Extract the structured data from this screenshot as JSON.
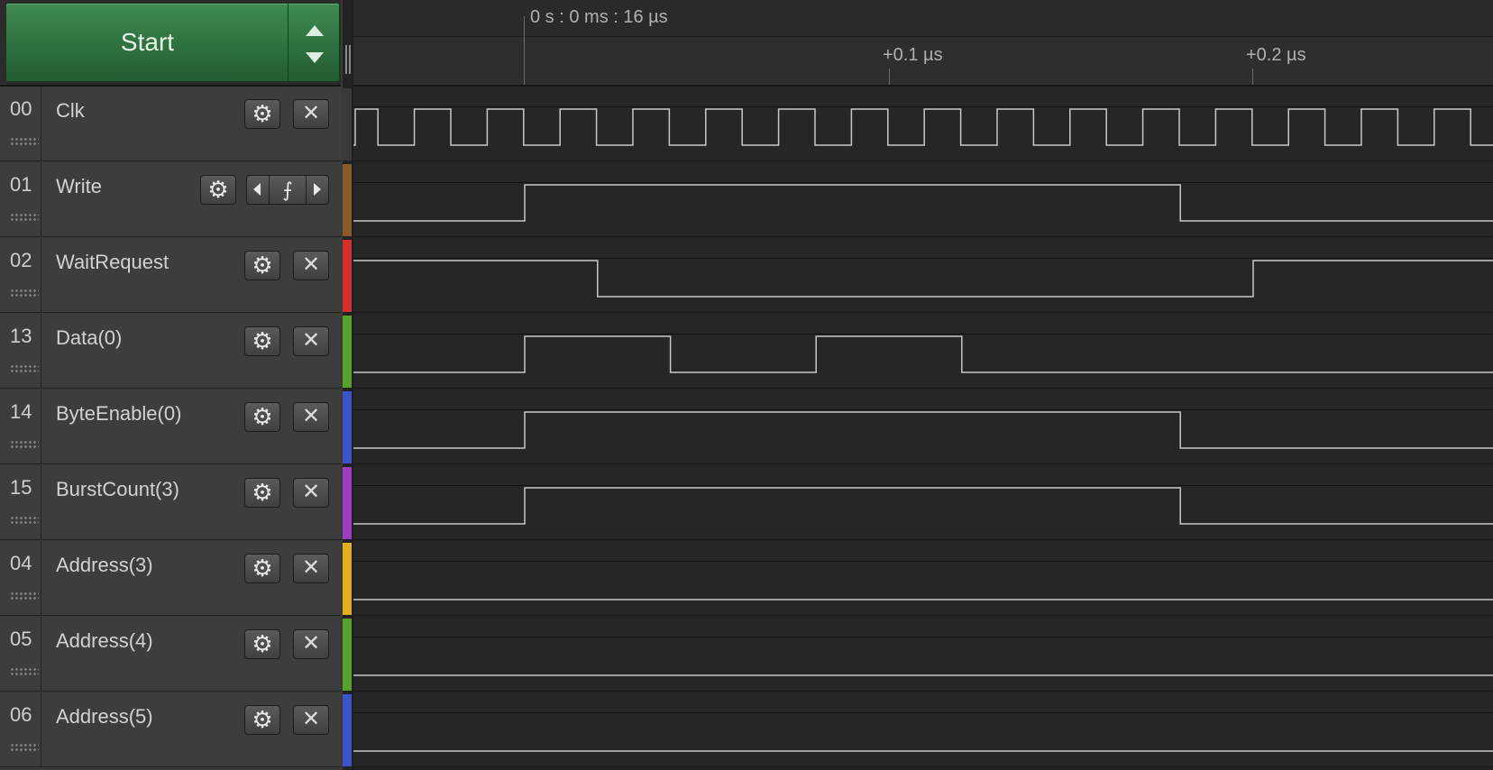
{
  "start_button": {
    "label": "Start"
  },
  "timeline": {
    "origin_label": "0 s : 0 ms : 16 µs",
    "ticks": [
      {
        "label": "+0.1 µs"
      },
      {
        "label": "+0.2 µs"
      }
    ]
  },
  "channels": [
    {
      "number": "00",
      "name": "Clk",
      "color": "#3a3a3a",
      "control": "settings"
    },
    {
      "number": "01",
      "name": "Write",
      "color": "#8b5a2b",
      "control": "trigger"
    },
    {
      "number": "02",
      "name": "WaitRequest",
      "color": "#d4302a",
      "control": "settings"
    },
    {
      "number": "13",
      "name": "Data(0)",
      "color": "#5aa02c",
      "control": "settings"
    },
    {
      "number": "14",
      "name": "ByteEnable(0)",
      "color": "#3b55c8",
      "control": "settings"
    },
    {
      "number": "15",
      "name": "BurstCount(3)",
      "color": "#9b3fbf",
      "control": "settings"
    },
    {
      "number": "04",
      "name": "Address(3)",
      "color": "#e0b020",
      "control": "settings"
    },
    {
      "number": "05",
      "name": "Address(4)",
      "color": "#5aa02c",
      "control": "settings"
    },
    {
      "number": "06",
      "name": "Address(5)",
      "color": "#3b55c8",
      "control": "settings"
    }
  ],
  "trigger": {
    "edge_symbol": "⨍"
  },
  "icons": {
    "settings": "gear-icon",
    "close": "close-icon",
    "rising_edge": "rising-edge-icon"
  },
  "signals": {
    "time_unit": "µs",
    "visible_start": -0.05,
    "visible_end": 0.24,
    "clk_period": 0.02,
    "clk_first_rise": -0.0503,
    "transitions": {
      "Write": {
        "initial": 0,
        "edges": [
          0.0,
          0.18
        ]
      },
      "WaitRequest": {
        "initial": 1,
        "edges": [
          0.02,
          0.2
        ]
      },
      "Data(0)": {
        "initial": 0,
        "edges": [
          0.0,
          0.04,
          0.08,
          0.12
        ]
      },
      "ByteEnable(0)": {
        "initial": 0,
        "edges": [
          0.0,
          0.18
        ]
      },
      "BurstCount(3)": {
        "initial": 0,
        "edges": [
          0.0,
          0.18
        ]
      },
      "Address(3)": {
        "initial": 0,
        "edges": []
      },
      "Address(4)": {
        "initial": 0,
        "edges": []
      },
      "Address(5)": {
        "initial": 0,
        "edges": []
      }
    }
  }
}
